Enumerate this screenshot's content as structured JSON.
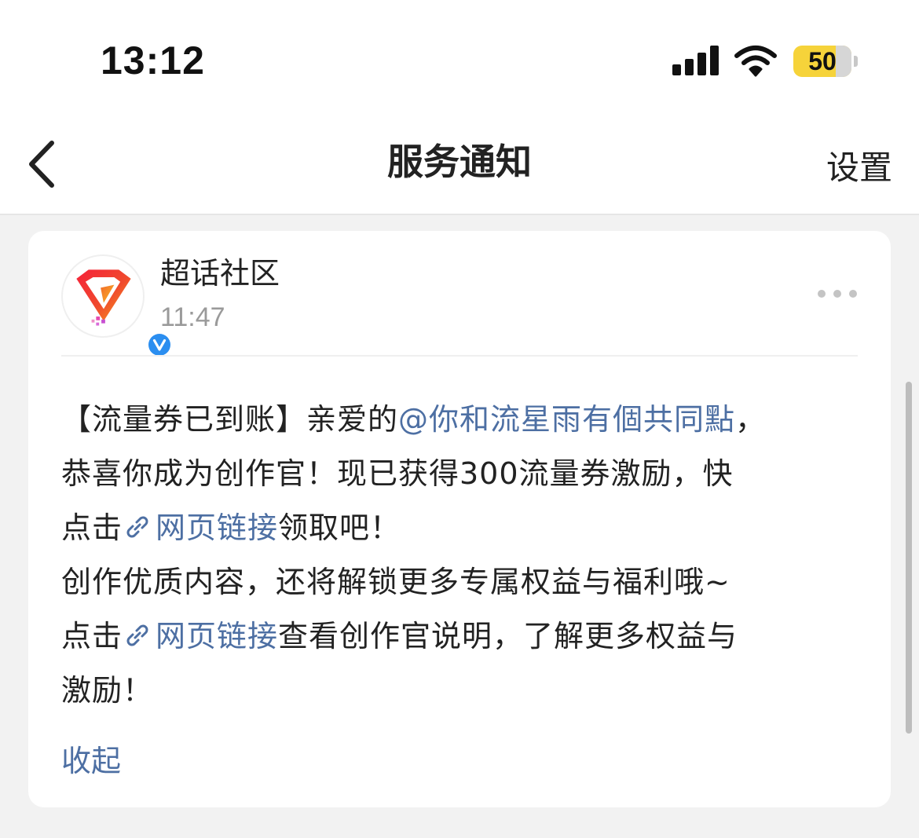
{
  "status_bar": {
    "time": "13:12",
    "battery_level": "50",
    "battery_fraction": 0.5,
    "icons": [
      "signal-icon",
      "wifi-icon",
      "battery-icon"
    ]
  },
  "nav": {
    "back_icon": "chevron-left-icon",
    "title": "服务通知",
    "settings_label": "设置"
  },
  "message": {
    "sender_name": "超话社区",
    "sender_time": "11:47",
    "avatar_icon": "diamond-logo-icon",
    "verified_icon": "verified-v-icon",
    "more_icon": "more-dots-icon",
    "lines": {
      "l1_prefix": "【流量券已到账】亲爱的",
      "l1_mention": "@你和流星雨有個共同點",
      "l1_suffix": "，",
      "l2": "恭喜你成为创作官！现已获得300流量券激励，快",
      "l3_prefix": "点击",
      "l3_link": "网页链接",
      "l3_suffix": "领取吧！",
      "l4": "创作优质内容，还将解锁更多专属权益与福利哦~",
      "l5_prefix": "点击",
      "l5_link": "网页链接",
      "l5_suffix": "查看创作官说明，了解更多权益与",
      "l6": "激励！"
    },
    "link_icon": "link-icon",
    "collapse_label": "收起"
  },
  "colors": {
    "link": "#4d6fa3",
    "battery": "#f6d33a",
    "verified": "#2b8ef0",
    "background": "#f2f2f2"
  }
}
